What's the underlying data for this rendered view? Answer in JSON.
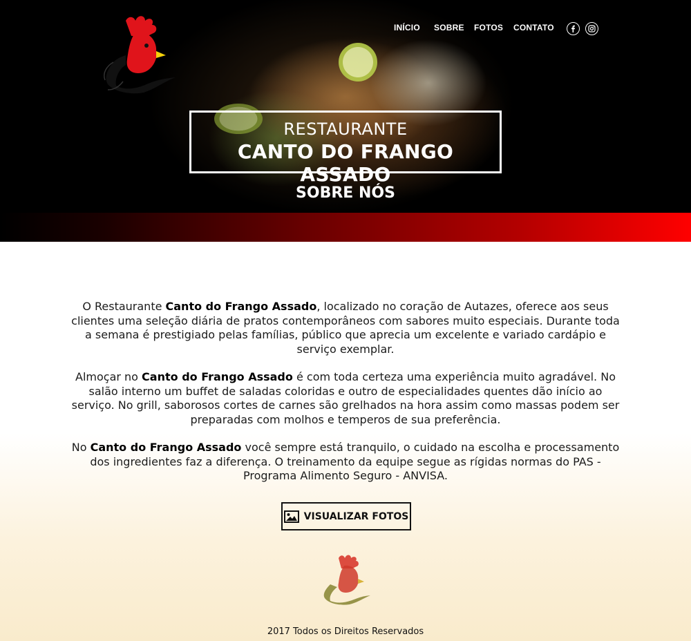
{
  "nav": {
    "items": [
      "INÍCIO",
      "SOBRE",
      "FOTOS",
      "CONTATO"
    ],
    "social": [
      {
        "icon": "facebook-icon",
        "glyph": "f"
      },
      {
        "icon": "instagram-icon",
        "glyph": ""
      }
    ]
  },
  "hero": {
    "subtitle": "RESTAURANTE",
    "title": "CANTO DO FRANGO ASSADO",
    "section_title": "SOBRE NÓS"
  },
  "about": {
    "paragraphs": [
      [
        {
          "t": "O Restaurante ",
          "b": false
        },
        {
          "t": "Canto do Frango Assado",
          "b": true
        },
        {
          "t": ", localizado no coração de Autazes, oferece aos seus clientes uma seleção diária de pratos contemporâneos com sabores muito especiais. Durante toda a semana é prestigiado pelas famílias, público que aprecia um excelente e variado cardápio e serviço exemplar.",
          "b": false
        }
      ],
      [
        {
          "t": "Almoçar no ",
          "b": false
        },
        {
          "t": "Canto do Frango Assado",
          "b": true
        },
        {
          "t": " é com toda certeza uma experiência muito agradável. No salão interno um buffet de saladas coloridas e outro de especialidades quentes dão início ao serviço. No grill, saborosos cortes de carnes são grelhados na hora assim como massas podem ser preparadas com molhos e temperos de sua preferência.",
          "b": false
        }
      ],
      [
        {
          "t": "No ",
          "b": false
        },
        {
          "t": "Canto do Frango Assado",
          "b": true
        },
        {
          "t": " você sempre está tranquilo, o cuidado na escolha e processamento dos ingredientes faz a diferença. O treinamento da equipe segue as rígidas normas do PAS - Programa Alimento Seguro - ANVISA.",
          "b": false
        }
      ]
    ],
    "button_label": "VISUALIZAR FOTOS",
    "button_icon": "image-icon"
  },
  "footer": {
    "text": "2017 Todos os Direitos Reservados"
  },
  "colors": {
    "accent_red": "#ff0000",
    "comb_red": "#e0141b",
    "beak_yellow": "#f5d20a"
  }
}
